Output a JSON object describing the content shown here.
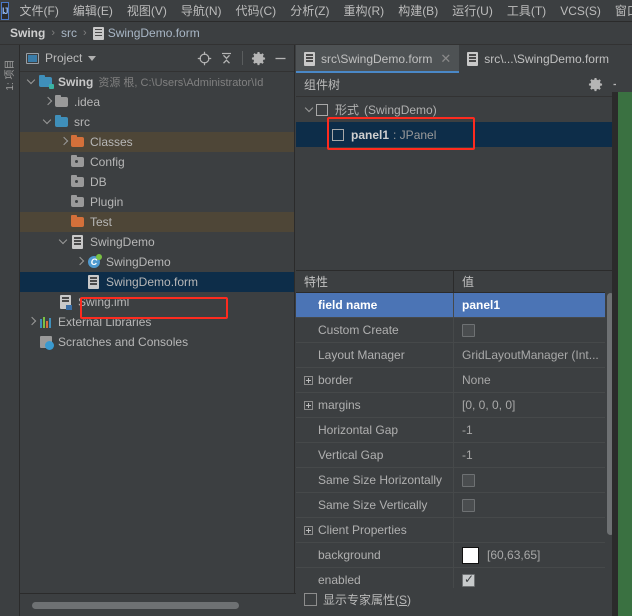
{
  "window": {
    "app_icon_text": "IJ"
  },
  "menubar": {
    "items": [
      {
        "label": "文件(F)"
      },
      {
        "label": "编辑(E)"
      },
      {
        "label": "视图(V)"
      },
      {
        "label": "导航(N)"
      },
      {
        "label": "代码(C)"
      },
      {
        "label": "分析(Z)"
      },
      {
        "label": "重构(R)"
      },
      {
        "label": "构建(B)"
      },
      {
        "label": "运行(U)"
      },
      {
        "label": "工具(T)"
      },
      {
        "label": "VCS(S)"
      },
      {
        "label": "窗口("
      }
    ]
  },
  "breadcrumb": {
    "items": [
      "Swing",
      "src",
      "SwingDemo.form"
    ],
    "separator": "›"
  },
  "toolstrip": {
    "vertical_tab": "1: 项目"
  },
  "project_panel": {
    "title": "Project",
    "tools": [
      {
        "name": "locate-icon",
        "tooltip": "Select Opened File"
      },
      {
        "name": "collapse-all-icon",
        "tooltip": "Collapse All"
      },
      {
        "name": "gear-icon",
        "tooltip": "Settings"
      },
      {
        "name": "minimize-icon",
        "tooltip": "Hide"
      }
    ],
    "tree": [
      {
        "label": "Swing",
        "suffix": "资源 根, C:\\Users\\Administrator\\Id",
        "depth": 0,
        "arrow": "down",
        "icon": "module-folder",
        "bold": true,
        "selected": "none"
      },
      {
        "label": ".idea",
        "suffix": "",
        "depth": 1,
        "arrow": "right",
        "icon": "folder-grey",
        "bold": false,
        "selected": "none"
      },
      {
        "label": "src",
        "suffix": "",
        "depth": 1,
        "arrow": "down",
        "icon": "folder-blue",
        "bold": false,
        "selected": "none"
      },
      {
        "label": "Classes",
        "suffix": "",
        "depth": 2,
        "arrow": "right",
        "icon": "folder-orange",
        "bold": false,
        "selected": "tan"
      },
      {
        "label": "Config",
        "suffix": "",
        "depth": 2,
        "arrow": "none",
        "icon": "folder-dot",
        "bold": false,
        "selected": "none"
      },
      {
        "label": "DB",
        "suffix": "",
        "depth": 2,
        "arrow": "none",
        "icon": "folder-dot",
        "bold": false,
        "selected": "none"
      },
      {
        "label": "Plugin",
        "suffix": "",
        "depth": 2,
        "arrow": "none",
        "icon": "folder-dot",
        "bold": false,
        "selected": "none"
      },
      {
        "label": "Test",
        "suffix": "",
        "depth": 2,
        "arrow": "none",
        "icon": "folder-orange",
        "bold": false,
        "selected": "tan"
      },
      {
        "label": "SwingDemo",
        "suffix": "",
        "depth": 2,
        "arrow": "down",
        "icon": "form-file",
        "bold": false,
        "selected": "none"
      },
      {
        "label": "SwingDemo",
        "suffix": "",
        "depth": 3,
        "arrow": "right",
        "icon": "java-class",
        "bold": false,
        "selected": "none"
      },
      {
        "label": "SwingDemo.form",
        "suffix": "",
        "depth": 3,
        "arrow": "none",
        "icon": "form-file",
        "bold": false,
        "selected": "blue"
      },
      {
        "label": "Swing.iml",
        "suffix": "",
        "depth": 1,
        "arrow": "none",
        "icon": "iml-file",
        "bold": false,
        "selected": "none"
      },
      {
        "label": "External Libraries",
        "suffix": "",
        "depth": 0,
        "arrow": "right",
        "icon": "library",
        "bold": false,
        "selected": "none"
      },
      {
        "label": "Scratches and Consoles",
        "suffix": "",
        "depth": 0,
        "arrow": "none",
        "icon": "scratches",
        "bold": false,
        "selected": "none"
      }
    ]
  },
  "editor": {
    "tabs": [
      {
        "label": "src\\SwingDemo.form",
        "active": true,
        "close": "✕"
      },
      {
        "label": "src\\...\\SwingDemo.form",
        "active": false,
        "close": ""
      }
    ]
  },
  "component_tree": {
    "title": "组件树",
    "tools": [
      {
        "name": "gear-icon"
      },
      {
        "name": "minimize-icon"
      }
    ],
    "rows": [
      {
        "name": "形式",
        "type": "(SwingDemo)",
        "depth": 0,
        "arrow": "down",
        "selected": false
      },
      {
        "name": "panel1",
        "type": ": JPanel",
        "depth": 1,
        "arrow": "none",
        "selected": true
      }
    ]
  },
  "properties": {
    "headers": {
      "key": "特性",
      "value": "值"
    },
    "rows": [
      {
        "key": "field name",
        "value": "panel1",
        "kind": "text",
        "expandable": false,
        "indent": true,
        "selected": true
      },
      {
        "key": "Custom Create",
        "value": "",
        "kind": "checkbox",
        "checked": false,
        "expandable": false,
        "indent": true,
        "selected": false
      },
      {
        "key": "Layout Manager",
        "value": "GridLayoutManager (Int...",
        "kind": "text",
        "expandable": false,
        "indent": true,
        "selected": false
      },
      {
        "key": "border",
        "value": "None",
        "kind": "text",
        "expandable": true,
        "indent": false,
        "selected": false
      },
      {
        "key": "margins",
        "value": "[0, 0, 0, 0]",
        "kind": "text",
        "expandable": true,
        "indent": false,
        "selected": false
      },
      {
        "key": "Horizontal Gap",
        "value": "-1",
        "kind": "text",
        "expandable": false,
        "indent": true,
        "selected": false
      },
      {
        "key": "Vertical Gap",
        "value": "-1",
        "kind": "text",
        "expandable": false,
        "indent": true,
        "selected": false
      },
      {
        "key": "Same Size Horizontally",
        "value": "",
        "kind": "checkbox",
        "checked": false,
        "expandable": false,
        "indent": true,
        "selected": false
      },
      {
        "key": "Same Size Vertically",
        "value": "",
        "kind": "checkbox",
        "checked": false,
        "expandable": false,
        "indent": true,
        "selected": false
      },
      {
        "key": "Client Properties",
        "value": "",
        "kind": "text",
        "expandable": true,
        "indent": false,
        "selected": false
      },
      {
        "key": "background",
        "value": "[60,63,65]",
        "kind": "color",
        "swatch": "#ffffff",
        "expandable": false,
        "indent": true,
        "selected": false
      },
      {
        "key": "enabled",
        "value": "",
        "kind": "checkbox",
        "checked": true,
        "expandable": false,
        "indent": true,
        "selected": false
      }
    ]
  },
  "expert": {
    "label_prefix": "显示专家属性(",
    "label_key": "S",
    "label_suffix": ")",
    "checked": false
  },
  "colors": {
    "window_bg": "#3c3f41",
    "selection_blue": "#0d2d49",
    "selection_tan": "#4e4637",
    "prop_selected": "#4b74b5",
    "tab_underline": "#4a88c7",
    "annotation_red": "#fd2b1f",
    "green_strip": "#3a7141"
  },
  "annotations": [
    {
      "name": "swingdemo-form-highlight"
    },
    {
      "name": "panel1-node-highlight"
    }
  ]
}
